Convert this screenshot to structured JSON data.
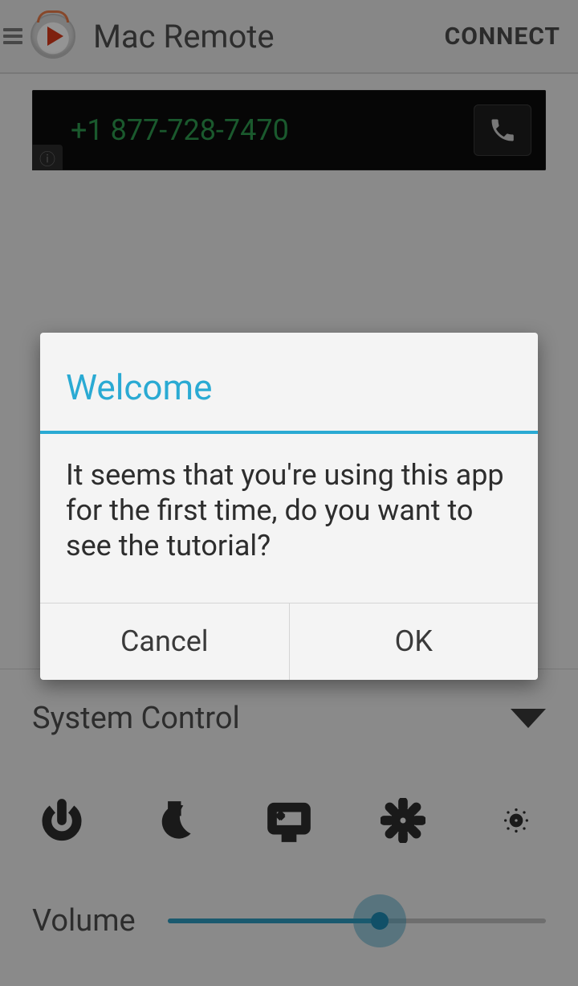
{
  "header": {
    "title": "Mac Remote",
    "connect_label": "CONNECT"
  },
  "ad": {
    "phone_number": "+1 877-728-7470"
  },
  "system_control": {
    "title": "System Control",
    "volume_label": "Volume",
    "volume_percent": 56
  },
  "dialog": {
    "title": "Welcome",
    "message": "It seems that you're using this app for the first time, do you want to see the tutorial?",
    "cancel_label": "Cancel",
    "ok_label": "OK"
  }
}
